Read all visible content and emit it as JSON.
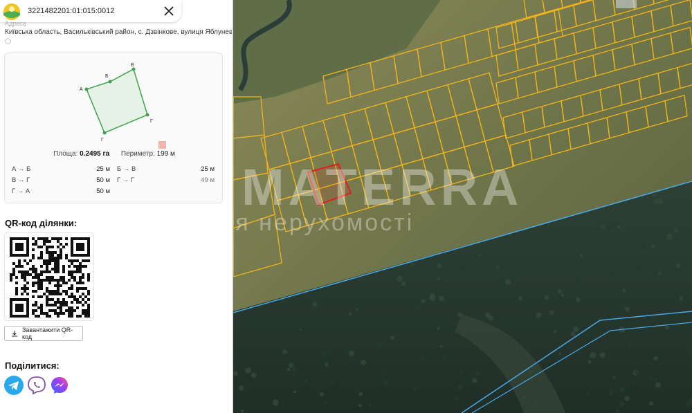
{
  "header": {
    "cadastral_number": "32214822​01:01:015:0012",
    "logo_icon": "land-logo-icon",
    "close_icon": "close-icon"
  },
  "address": {
    "label": "Адреса",
    "value": "Київська область, Васильківський район, с. Дзвінкове, вулиця Яблунева"
  },
  "plot_card": {
    "vertices": [
      "А",
      "Б",
      "В",
      "Г"
    ],
    "area_label": "Площа:",
    "area_value": "0.2495 га",
    "perimeter_label": "Периметр:",
    "perimeter_value": "199 м",
    "sides": [
      {
        "label": "А → Б",
        "value": "25 м"
      },
      {
        "label": "Б → В",
        "value": "25 м"
      },
      {
        "label": "В → Г",
        "value": "50 м"
      },
      {
        "label": "Г → Г",
        "value": "49 м"
      },
      {
        "label": "Г → А",
        "value": "50 м"
      }
    ],
    "accent_color": "#3fa34d"
  },
  "qr": {
    "title": "QR-код ділянки:",
    "download_label": "Завантажити QR-код"
  },
  "share": {
    "title": "Поділитися:",
    "icons": [
      "telegram-icon",
      "viber-icon",
      "messenger-icon"
    ]
  },
  "map": {
    "watermark_main": "MATERRA",
    "watermark_sub": "агенція нерухомості",
    "parcel_color": "#f2b51a",
    "selected_color": "#e0201c",
    "boundary_color": "#4aa8e8"
  }
}
